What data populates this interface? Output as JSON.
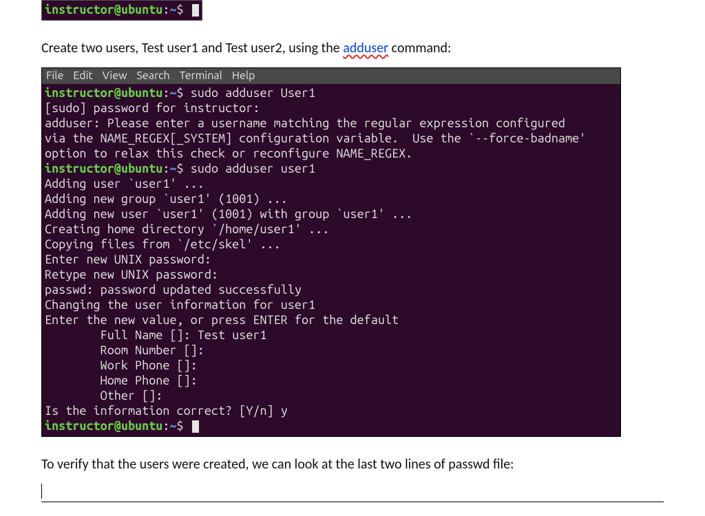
{
  "promptSmall": {
    "user": "instructor@ubuntu",
    "sep": ":",
    "path": "~",
    "dollar": "$ "
  },
  "para1_a": "Create two users, Test user1 and Test user2, using the ",
  "para1_cmd": "adduser",
  "para1_b": " command:",
  "menubar": [
    "File",
    "Edit",
    "View",
    "Search",
    "Terminal",
    "Help"
  ],
  "lines": [
    {
      "type": "prompt",
      "user": "instructor@ubuntu",
      "sep": ":",
      "path": "~",
      "dollar": "$ ",
      "cmd": "sudo adduser User1"
    },
    {
      "type": "out",
      "text": "[sudo] password for instructor:"
    },
    {
      "type": "out",
      "text": "adduser: Please enter a username matching the regular expression configured"
    },
    {
      "type": "out",
      "text": "via the NAME_REGEX[_SYSTEM] configuration variable.  Use the `--force-badname'"
    },
    {
      "type": "out",
      "text": "option to relax this check or reconfigure NAME_REGEX."
    },
    {
      "type": "prompt",
      "user": "instructor@ubuntu",
      "sep": ":",
      "path": "~",
      "dollar": "$ ",
      "cmd": "sudo adduser user1"
    },
    {
      "type": "out",
      "text": "Adding user `user1' ..."
    },
    {
      "type": "out",
      "text": "Adding new group `user1' (1001) ..."
    },
    {
      "type": "out",
      "text": "Adding new user `user1' (1001) with group `user1' ..."
    },
    {
      "type": "out",
      "text": "Creating home directory `/home/user1' ..."
    },
    {
      "type": "out",
      "text": "Copying files from `/etc/skel' ..."
    },
    {
      "type": "out",
      "text": "Enter new UNIX password:"
    },
    {
      "type": "out",
      "text": "Retype new UNIX password:"
    },
    {
      "type": "out",
      "text": "passwd: password updated successfully"
    },
    {
      "type": "out",
      "text": "Changing the user information for user1"
    },
    {
      "type": "out",
      "text": "Enter the new value, or press ENTER for the default"
    },
    {
      "type": "out",
      "text": "        Full Name []: Test user1"
    },
    {
      "type": "out",
      "text": "        Room Number []:"
    },
    {
      "type": "out",
      "text": "        Work Phone []:"
    },
    {
      "type": "out",
      "text": "        Home Phone []:"
    },
    {
      "type": "out",
      "text": "        Other []:"
    },
    {
      "type": "out",
      "text": "Is the information correct? [Y/n] y"
    },
    {
      "type": "prompt",
      "user": "instructor@ubuntu",
      "sep": ":",
      "path": "~",
      "dollar": "$ ",
      "cmd": "",
      "cursor": true
    }
  ],
  "para2": "To verify that the users were created, we can look at the last two lines of passwd file:"
}
